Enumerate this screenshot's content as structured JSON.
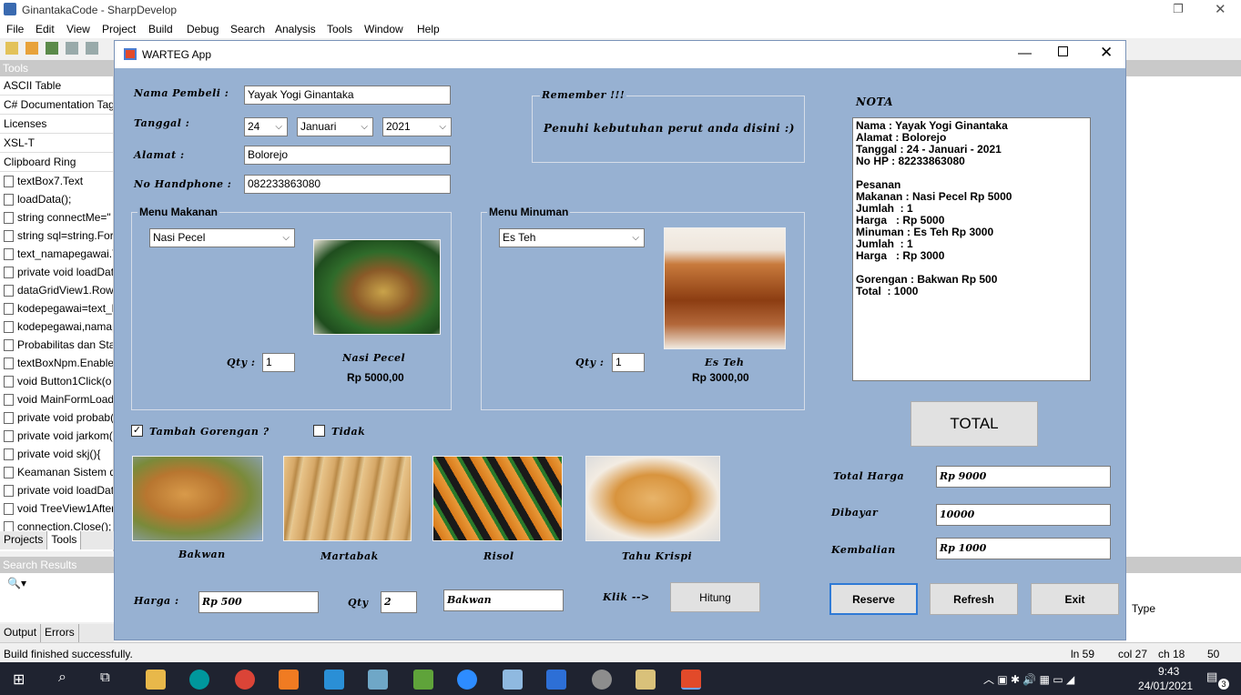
{
  "ide": {
    "title": "GinantakaCode - SharpDevelop",
    "menu": [
      "File",
      "Edit",
      "View",
      "Project",
      "Build",
      "Debug",
      "Search",
      "Analysis",
      "Tools",
      "Window",
      "Help"
    ],
    "tools_header": "Tools",
    "tool_categories": [
      "ASCII Table",
      "C# Documentation Tags",
      "Licenses",
      "XSL-T",
      "Clipboard Ring"
    ],
    "clipboard_items": [
      "textBox7.Text",
      "loadData();",
      "string connectMe=\"",
      "string sql=string.For",
      "text_namapegawai.T",
      "private void loadDat",
      "dataGridView1.Rows",
      "kodepegawai=text_k",
      "kodepegawai,namap",
      "Probabilitas dan Stat",
      "textBoxNpm.Enable",
      "void Button1Click(o",
      "void MainFormLoad",
      "private void probab(",
      "private void jarkom(",
      "private void skj(){",
      "Keamanan Sistem da",
      "private void loadDat",
      "void TreeView1After",
      "connection.Close();"
    ],
    "side_tabs": [
      "Projects",
      "Tools"
    ],
    "search_results_header": "Search Results",
    "bottom_tabs": [
      "Output",
      "Errors"
    ],
    "right_col_header": "Type",
    "status": {
      "message": "Build finished successfully.",
      "line": "ln 59",
      "col": "col 27",
      "ch": "ch 18",
      "num": "50"
    },
    "clock": {
      "time": "9:43",
      "date": "24/01/2021",
      "notif": "3"
    }
  },
  "window": {
    "title": "WARTEG App",
    "labels": {
      "nama": "Nama Pembeli :",
      "tanggal": "Tanggal   :",
      "alamat": "Alamat   :",
      "hp": "No Handphone :",
      "remember": "Remember !!!",
      "remember_msg": "Penuhi kebutuhan perut anda disini :)",
      "nota": "NOTA",
      "qty": "Qty :",
      "tambah": "Tambah Gorengan ?",
      "tidak": "Tidak",
      "harga": "Harga   :",
      "qty2": "Qty",
      "klik": "Klik -->",
      "total_harga": "Total Harga",
      "dibayar": "Dibayar",
      "kembalian": "Kembalian"
    },
    "fields": {
      "nama": "Yayak Yogi Ginantaka",
      "tgl_day": "24",
      "tgl_month": "Januari",
      "tgl_year": "2021",
      "alamat": "Bolorejo",
      "hp": "082233863080",
      "harga": "Rp 500",
      "qty": "2",
      "gorengan": "Bakwan",
      "total_harga": "Rp 9000",
      "dibayar": "10000",
      "kembalian": "Rp 1000"
    },
    "makanan": {
      "group": "Menu Makanan",
      "selected": "Nasi Pecel",
      "qty": "1",
      "name": "Nasi Pecel",
      "price": "Rp 5000,00"
    },
    "minuman": {
      "group": "Menu Minuman",
      "selected": "Es Teh",
      "qty": "1",
      "name": "Es Teh",
      "price": "Rp 3000,00"
    },
    "gorengan_items": [
      "Bakwan",
      "Martabak",
      "Risol",
      "Tahu Krispi"
    ],
    "tambah_checked": true,
    "tidak_checked": false,
    "nota_lines": [
      "Nama : Yayak Yogi Ginantaka",
      "Alamat : Bolorejo",
      "Tanggal : 24 - Januari - 2021",
      "No HP : 82233863080",
      "",
      "Pesanan",
      "Makanan : Nasi Pecel Rp 5000",
      "Jumlah  : 1",
      "Harga   : Rp 5000",
      "Minuman : Es Teh Rp 3000",
      "Jumlah  : 1",
      "Harga   : Rp 3000",
      "",
      "Gorengan : Bakwan Rp 500",
      "Total  : 1000"
    ],
    "buttons": {
      "total": "TOTAL",
      "hitung": "Hitung",
      "reserve": "Reserve",
      "refresh": "Refresh",
      "exit": "Exit"
    }
  }
}
